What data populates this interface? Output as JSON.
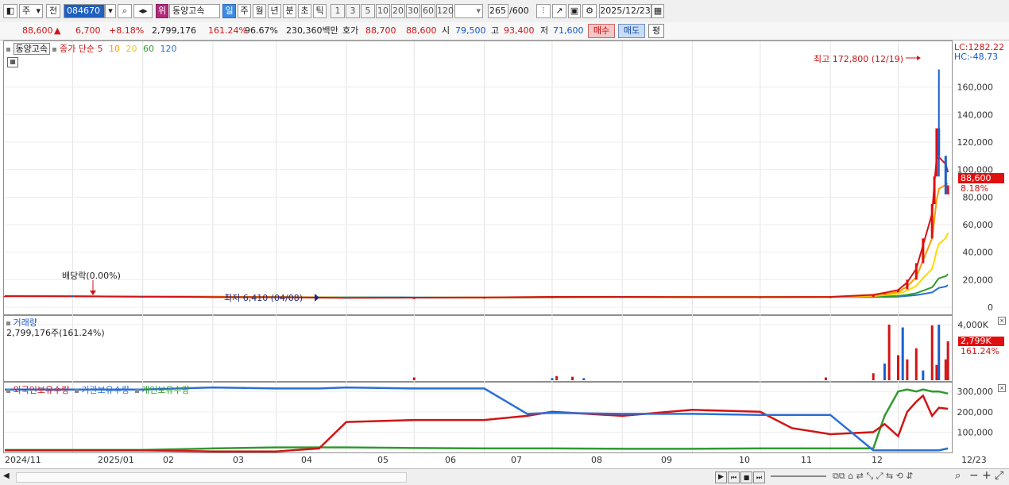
{
  "toolbar": {
    "period_short": "주",
    "prev_label": "전",
    "stock_code": "084670",
    "stock_badge": "위",
    "stock_name": "동양고속",
    "periods": [
      "일",
      "주",
      "월",
      "년",
      "분",
      "초",
      "틱"
    ],
    "active_period": "일",
    "intervals": [
      "1",
      "3",
      "5",
      "10",
      "20",
      "30",
      "60",
      "120"
    ],
    "count": "265",
    "count_max": "/600",
    "date": "2025/12/23"
  },
  "quote": {
    "price": "88,600",
    "change_arrow": "▲",
    "change": "6,700",
    "change_pct": "+8.18%",
    "volume": "2,799,176",
    "volume_pct": "161.24%",
    "ratio": "96.67%",
    "amount": "230,360백만",
    "ask_label": "호가",
    "ask": "88,700",
    "bid": "88,600",
    "open_label": "시",
    "open": "79,500",
    "high_label": "고",
    "high": "93,400",
    "low_label": "저",
    "low": "71,600",
    "buy_label": "매수",
    "sell_label": "매도",
    "eval_label": "평"
  },
  "price_panel": {
    "legend_name": "동양고속",
    "legend_ma": "종가 단순",
    "ma_periods": [
      "5",
      "10",
      "20",
      "60",
      "120"
    ],
    "ma_colors": [
      "#d21414",
      "#ff9900",
      "#ffd800",
      "#2f9a2f",
      "#2a6fd6"
    ],
    "lc_label": "LC:1282.22",
    "hc_label": "HC:-48.73",
    "max_annotation": "최고 172,800 (12/19)",
    "min_annotation": "최저 6,410 (04/08)",
    "dividend_annotation": "배당락(0.00%)",
    "current_price_tag": "88,600",
    "current_pct_tag": "8.18%"
  },
  "volume_panel": {
    "title": "거래량",
    "info": "2,799,176주(161.24%)",
    "tag": "2,799K",
    "tag_pct": "161.24%"
  },
  "holding_panel": {
    "legend": [
      "외국인보유수량",
      "기관보유수량",
      "개인보유수량"
    ],
    "colors": [
      "#d21414",
      "#2a6fd6",
      "#2f9a2f"
    ]
  },
  "x_labels": [
    "2024/11",
    "2025/01",
    "02",
    "03",
    "04",
    "05",
    "06",
    "07",
    "08",
    "09",
    "10",
    "11",
    "12",
    "12/23"
  ],
  "chart_data": [
    {
      "type": "candlestick",
      "title": "동양고속",
      "ylim": [
        -3000,
        175000
      ],
      "y_ticks": [
        "0",
        "20,000",
        "40,000",
        "60,000",
        "80,000",
        "100,000",
        "120,000",
        "140,000",
        "160,000"
      ],
      "series": [
        {
          "name": "종가",
          "x": [
            "2024/11",
            "2024/12",
            "2025/01",
            "2025/02",
            "2025/03",
            "2025/04",
            "2025/05",
            "2025/06",
            "2025/07",
            "2025/08",
            "2025/09",
            "2025/10",
            "2025/11",
            "2025/11/20",
            "2025/11/25",
            "2025/12/01",
            "2025/12/05",
            "2025/12/09",
            "2025/12/12",
            "2025/12/16",
            "2025/12/17",
            "2025/12/18",
            "2025/12/19",
            "2025/12/22",
            "2025/12/23"
          ],
          "values": [
            8200,
            7800,
            7500,
            7400,
            7100,
            6600,
            6800,
            7100,
            7600,
            7500,
            7400,
            7300,
            7500,
            9500,
            11000,
            13000,
            20000,
            32000,
            50000,
            75000,
            95000,
            130000,
            110000,
            82000,
            88600
          ]
        },
        {
          "name": "5",
          "values": [
            8100,
            7900,
            7600,
            7400,
            7200,
            6800,
            6900,
            7100,
            7500,
            7500,
            7400,
            7300,
            7500,
            9000,
            10500,
            12500,
            18000,
            28000,
            45000,
            68000,
            90000,
            108000,
            109000,
            104000,
            98000
          ]
        },
        {
          "name": "10",
          "values": [
            8100,
            7900,
            7600,
            7400,
            7200,
            6900,
            6900,
            7100,
            7400,
            7500,
            7400,
            7300,
            7400,
            8500,
            9500,
            11000,
            15000,
            22000,
            34000,
            50000,
            64000,
            78000,
            86000,
            89000,
            90000
          ]
        },
        {
          "name": "20",
          "values": [
            8000,
            7900,
            7600,
            7500,
            7300,
            7000,
            6900,
            7000,
            7300,
            7400,
            7400,
            7300,
            7400,
            8000,
            8800,
            9800,
            12000,
            15500,
            21000,
            28000,
            34000,
            41000,
            46000,
            50000,
            54000
          ]
        },
        {
          "name": "60",
          "values": [
            8000,
            7900,
            7700,
            7500,
            7300,
            7100,
            7000,
            7000,
            7200,
            7300,
            7400,
            7300,
            7300,
            7500,
            7800,
            8200,
            9000,
            10200,
            12000,
            14500,
            16500,
            19000,
            21000,
            22500,
            24000
          ]
        },
        {
          "name": "120",
          "values": [
            7900,
            7900,
            7800,
            7600,
            7400,
            7200,
            7100,
            7000,
            7100,
            7200,
            7300,
            7300,
            7300,
            7400,
            7500,
            7700,
            8200,
            8800,
            9600,
            10800,
            11800,
            13000,
            14000,
            15000,
            16000
          ]
        }
      ],
      "annotations": [
        "최고 172,800 (12/19)",
        "최저 6,410 (04/08)",
        "배당락(0.00%)"
      ]
    },
    {
      "type": "bar",
      "title": "거래량",
      "ylim": [
        0,
        4200000
      ],
      "y_ticks": [
        "4,000K"
      ],
      "x": [
        "2025/05/01",
        "2025/07/01",
        "2025/07/03",
        "2025/07/10",
        "2025/07/15",
        "2025/10/30",
        "2025/11/20",
        "2025/11/25",
        "2025/11/27",
        "2025/12/01",
        "2025/12/03",
        "2025/12/05",
        "2025/12/09",
        "2025/12/12",
        "2025/12/16",
        "2025/12/18",
        "2025/12/19",
        "2025/12/22",
        "2025/12/23"
      ],
      "values": [
        200000,
        150000,
        300000,
        250000,
        150000,
        200000,
        500000,
        1200000,
        4000000,
        1800000,
        3800000,
        1500000,
        2300000,
        700000,
        3950000,
        1100000,
        4000000,
        1500000,
        2799176
      ]
    },
    {
      "type": "line",
      "title": "보유수량",
      "ylim": [
        0,
        340000
      ],
      "y_ticks": [
        "100,000",
        "200,000",
        "300,000"
      ],
      "series": [
        {
          "name": "외국인보유수량",
          "x": [
            "2024/11",
            "2025/01",
            "2025/02",
            "2025/03",
            "2025/03/20",
            "2025/04",
            "2025/05",
            "2025/06",
            "2025/06/20",
            "2025/07",
            "2025/08",
            "2025/09",
            "2025/10",
            "2025/10/15",
            "2025/11",
            "2025/11/20",
            "2025/11/25",
            "2025/12/01",
            "2025/12/05",
            "2025/12/09",
            "2025/12/12",
            "2025/12/16",
            "2025/12/19",
            "2025/12/23"
          ],
          "values": [
            10000,
            10000,
            5000,
            5000,
            20000,
            150000,
            160000,
            160000,
            180000,
            200000,
            180000,
            210000,
            200000,
            120000,
            90000,
            100000,
            140000,
            80000,
            200000,
            250000,
            280000,
            180000,
            220000,
            215000
          ]
        },
        {
          "name": "기관보유수량",
          "values": [
            310000,
            310000,
            320000,
            315000,
            315000,
            320000,
            315000,
            315000,
            190000,
            195000,
            190000,
            190000,
            185000,
            185000,
            185000,
            10000,
            10000,
            10000,
            10000,
            10000,
            10000,
            10000,
            10000,
            20000
          ]
        },
        {
          "name": "개인보유수량",
          "values": [
            12000,
            12000,
            20000,
            25000,
            25000,
            25000,
            22000,
            20000,
            20000,
            20000,
            18000,
            18000,
            20000,
            20000,
            20000,
            20000,
            180000,
            300000,
            310000,
            300000,
            310000,
            300000,
            300000,
            290000
          ]
        }
      ],
      "legend": "top-left"
    }
  ]
}
